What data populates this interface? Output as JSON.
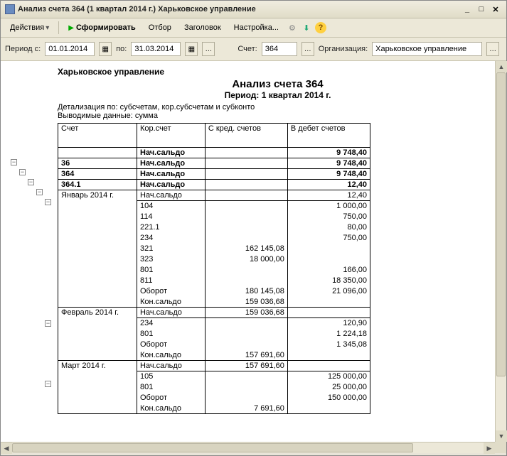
{
  "window": {
    "title": "Анализ счета 364 (1 квартал 2014 г.) Харьковское управление"
  },
  "toolbar": {
    "actions": "Действия",
    "form": "Сформировать",
    "filter": "Отбор",
    "header": "Заголовок",
    "settings": "Настройка..."
  },
  "filters": {
    "period_from_lbl": "Период с:",
    "period_from": "01.01.2014",
    "period_to_lbl": "по:",
    "period_to": "31.03.2014",
    "account_lbl": "Счет:",
    "account": "364",
    "org_lbl": "Организация:",
    "org": "Харьковское управление"
  },
  "report": {
    "org": "Харьковское управление",
    "title": "Анализ счета 364",
    "period": "Период: 1 квартал 2014 г.",
    "detail": "Детализация по: субсчетам, кор.субсчетам и субконто",
    "out": "Выводимые данные: сумма",
    "hdr": {
      "c1": "Счет",
      "c2": "Кор.счет",
      "c3": "С кред. счетов",
      "c4": "В дебет счетов"
    },
    "rows": [
      {
        "b": true,
        "c1": "",
        "c2": "Нач.сальдо",
        "c3": "",
        "c4": "9 748,40"
      },
      {
        "b": true,
        "c1": "36",
        "c2": "Нач.сальдо",
        "c3": "",
        "c4": "9 748,40"
      },
      {
        "b": true,
        "c1": "364",
        "c2": "Нач.сальдо",
        "c3": "",
        "c4": "9 748,40"
      },
      {
        "b": true,
        "c1": "364.1",
        "c2": "Нач.сальдо",
        "c3": "",
        "c4": "12,40"
      },
      {
        "b": false,
        "c1": "Январь 2014 г.",
        "c2": "Нач.сальдо",
        "c3": "",
        "c4": "12,40",
        "g": "s"
      },
      {
        "b": false,
        "c1": "",
        "c2": "104",
        "c3": "",
        "c4": "1 000,00",
        "g": "m"
      },
      {
        "b": false,
        "c1": "",
        "c2": "114",
        "c3": "",
        "c4": "750,00",
        "g": "m"
      },
      {
        "b": false,
        "c1": "",
        "c2": "221.1",
        "c3": "",
        "c4": "80,00",
        "g": "m"
      },
      {
        "b": false,
        "c1": "",
        "c2": "234",
        "c3": "",
        "c4": "750,00",
        "g": "m"
      },
      {
        "b": false,
        "c1": "",
        "c2": "321",
        "c3": "162 145,08",
        "c4": "",
        "g": "m"
      },
      {
        "b": false,
        "c1": "",
        "c2": "323",
        "c3": "18 000,00",
        "c4": "",
        "g": "m"
      },
      {
        "b": false,
        "c1": "",
        "c2": "801",
        "c3": "",
        "c4": "166,00",
        "g": "m"
      },
      {
        "b": false,
        "c1": "",
        "c2": "811",
        "c3": "",
        "c4": "18 350,00",
        "g": "m"
      },
      {
        "b": false,
        "c1": "",
        "c2": "Оборот",
        "c3": "180 145,08",
        "c4": "21 096,00",
        "g": "m"
      },
      {
        "b": false,
        "c1": "",
        "c2": "Кон.сальдо",
        "c3": "159 036,68",
        "c4": "",
        "g": "e"
      },
      {
        "b": false,
        "c1": "Февраль 2014 г.",
        "c2": "Нач.сальдо",
        "c3": "159 036,68",
        "c4": "",
        "g": "s"
      },
      {
        "b": false,
        "c1": "",
        "c2": "234",
        "c3": "",
        "c4": "120,90",
        "g": "m"
      },
      {
        "b": false,
        "c1": "",
        "c2": "801",
        "c3": "",
        "c4": "1 224,18",
        "g": "m"
      },
      {
        "b": false,
        "c1": "",
        "c2": "Оборот",
        "c3": "",
        "c4": "1 345,08",
        "g": "m"
      },
      {
        "b": false,
        "c1": "",
        "c2": "Кон.сальдо",
        "c3": "157 691,60",
        "c4": "",
        "g": "e"
      },
      {
        "b": false,
        "c1": "Март 2014 г.",
        "c2": "Нач.сальдо",
        "c3": "157 691,60",
        "c4": "",
        "g": "s"
      },
      {
        "b": false,
        "c1": "",
        "c2": "105",
        "c3": "",
        "c4": "125 000,00",
        "g": "m"
      },
      {
        "b": false,
        "c1": "",
        "c2": "801",
        "c3": "",
        "c4": "25 000,00",
        "g": "m"
      },
      {
        "b": false,
        "c1": "",
        "c2": "Оборот",
        "c3": "",
        "c4": "150 000,00",
        "g": "m"
      },
      {
        "b": false,
        "c1": "",
        "c2": "Кон.сальдо",
        "c3": "7 691,60",
        "c4": "",
        "g": "e"
      }
    ]
  }
}
